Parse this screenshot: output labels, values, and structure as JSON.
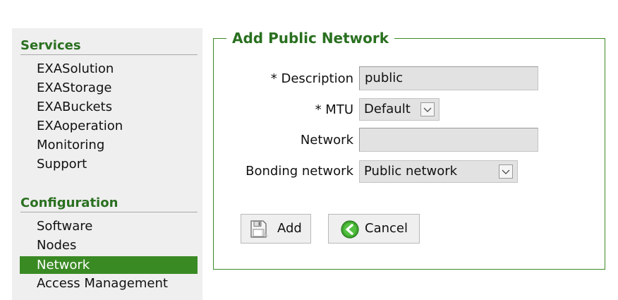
{
  "sidebar": {
    "sections": [
      {
        "title": "Services",
        "items": [
          {
            "label": "EXASolution"
          },
          {
            "label": "EXAStorage"
          },
          {
            "label": "EXABuckets"
          },
          {
            "label": "EXAoperation"
          },
          {
            "label": "Monitoring"
          },
          {
            "label": "Support"
          }
        ]
      },
      {
        "title": "Configuration",
        "items": [
          {
            "label": "Software"
          },
          {
            "label": "Nodes"
          },
          {
            "label": "Network",
            "active": true
          },
          {
            "label": "Access Management"
          }
        ]
      }
    ]
  },
  "form": {
    "legend": "Add Public Network",
    "description": {
      "label": "* Description",
      "value": "public"
    },
    "mtu": {
      "label": "* MTU",
      "value": "Default"
    },
    "network": {
      "label": "Network",
      "value": ""
    },
    "bonding": {
      "label": "Bonding network",
      "value": "Public network"
    },
    "add_button": {
      "label": "Add",
      "icon": "floppy-disk-icon"
    },
    "cancel_button": {
      "label": "Cancel",
      "icon": "cancel-back-icon"
    }
  },
  "colors": {
    "accent": "#3a8a24",
    "heading": "#2a7020",
    "sidebar_bg": "#efefef",
    "field_bg": "#e2e2e2"
  }
}
